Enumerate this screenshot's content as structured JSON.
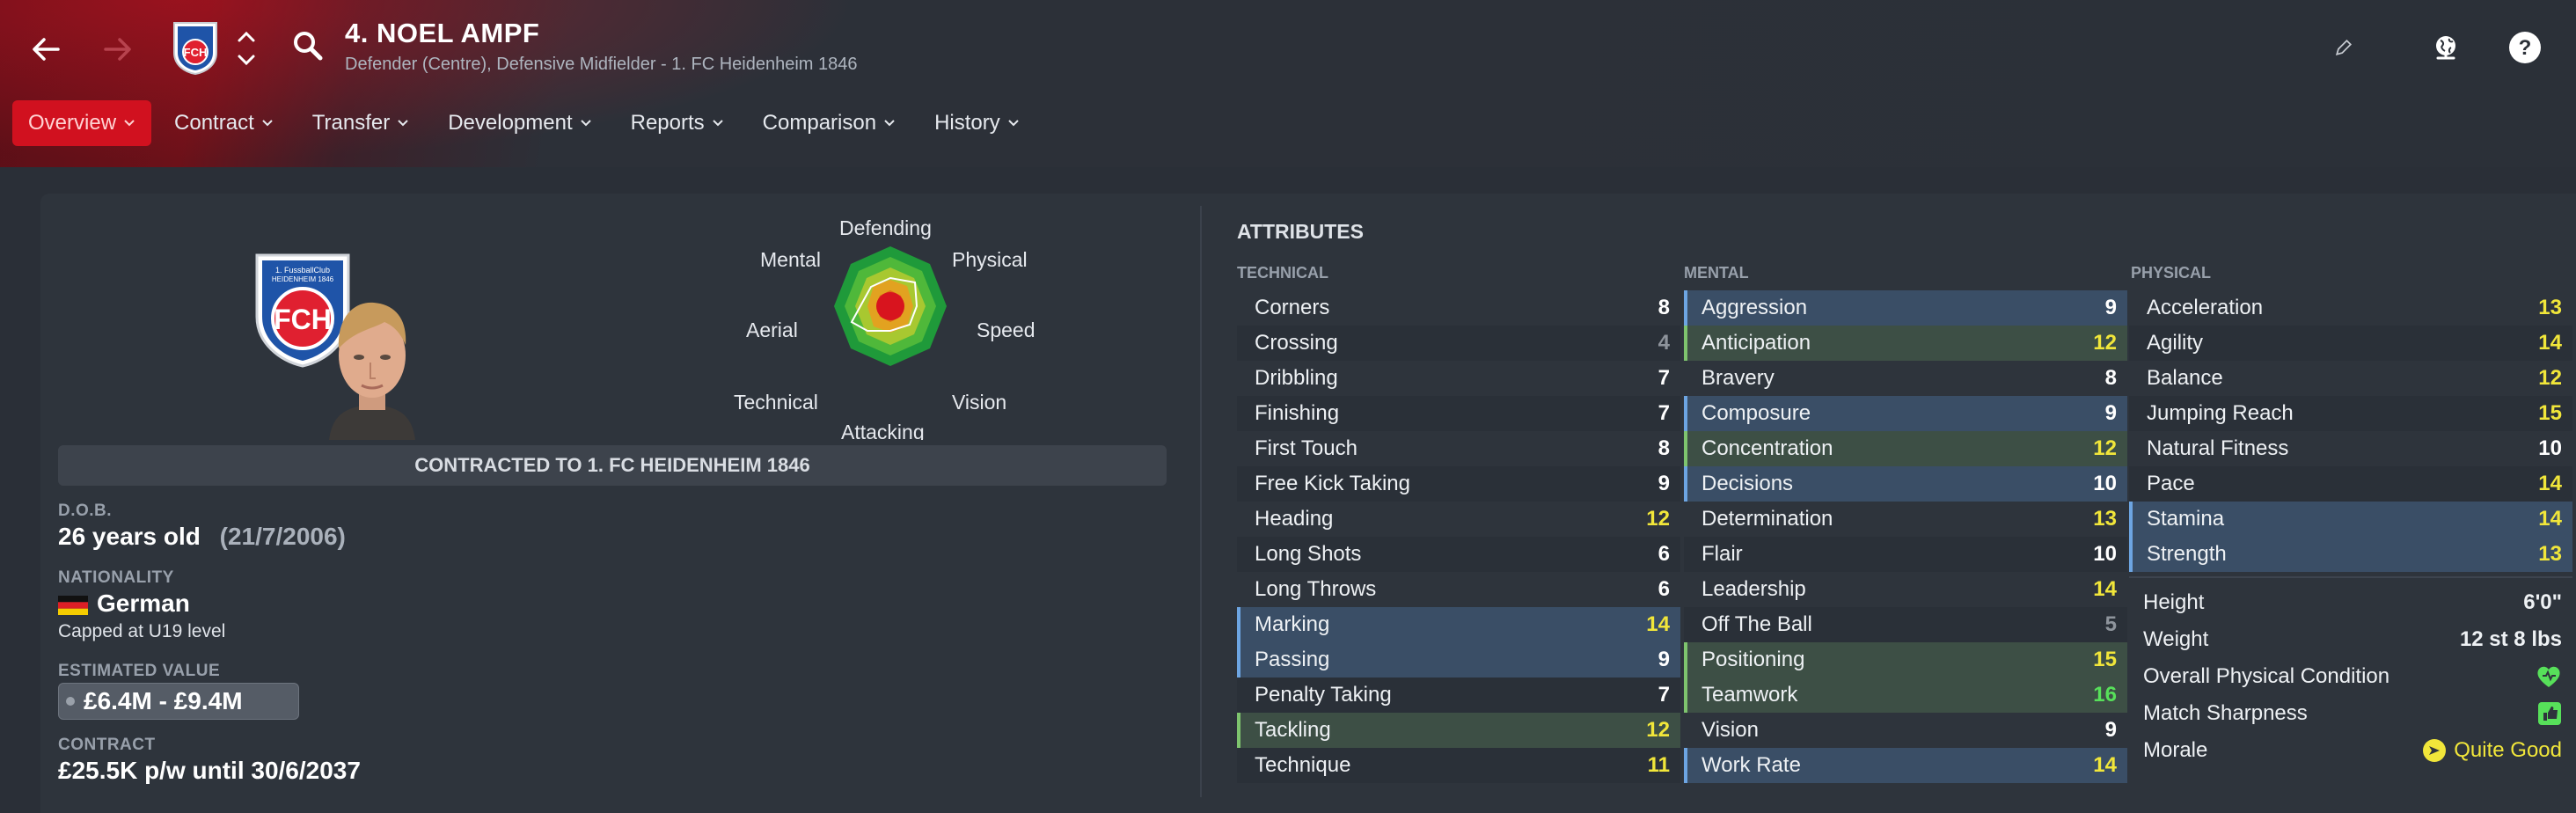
{
  "header": {
    "player_name": "4. NOEL AMPF",
    "subtitle": "Defender (Centre), Defensive Midfielder - 1. FC Heidenheim 1846",
    "back_icon": "arrow-left-icon",
    "forward_icon": "arrow-right-icon",
    "search_icon": "search-icon",
    "edit_icon": "pencil-icon",
    "globe_icon": "globe-icon",
    "help_icon": "help-icon",
    "crest_text": "FCH"
  },
  "tabs": [
    {
      "label": "Overview",
      "active": true
    },
    {
      "label": "Contract"
    },
    {
      "label": "Transfer"
    },
    {
      "label": "Development"
    },
    {
      "label": "Reports"
    },
    {
      "label": "Comparison"
    },
    {
      "label": "History"
    }
  ],
  "crest": {
    "top_text": "1. FussballClub",
    "sub_text": "HEIDENHEIM 1846",
    "main_text": "FCH"
  },
  "radar": {
    "labels": [
      "Defending",
      "Physical",
      "Speed",
      "Vision",
      "Attacking",
      "Technical",
      "Aerial",
      "Mental"
    ]
  },
  "summary": {
    "contract_banner": "CONTRACTED TO 1. FC HEIDENHEIM 1846",
    "dob_label": "D.O.B.",
    "age": "26 years old",
    "dob": "(21/7/2006)",
    "nationality_label": "NATIONALITY",
    "nationality": "German",
    "caps": "Capped at U19 level",
    "value_label": "ESTIMATED VALUE",
    "value": "£6.4M - £9.4M",
    "contract_label": "CONTRACT",
    "contract": "£25.5K p/w until 30/6/2037"
  },
  "attributes": {
    "title": "ATTRIBUTES",
    "technical_title": "TECHNICAL",
    "mental_title": "MENTAL",
    "physical_title": "PHYSICAL",
    "technical": [
      {
        "name": "Corners",
        "value": "8",
        "tone": "white"
      },
      {
        "name": "Crossing",
        "value": "4",
        "tone": "grey"
      },
      {
        "name": "Dribbling",
        "value": "7",
        "tone": "white"
      },
      {
        "name": "Finishing",
        "value": "7",
        "tone": "white"
      },
      {
        "name": "First Touch",
        "value": "8",
        "tone": "white"
      },
      {
        "name": "Free Kick Taking",
        "value": "9",
        "tone": "white"
      },
      {
        "name": "Heading",
        "value": "12",
        "tone": "yellow"
      },
      {
        "name": "Long Shots",
        "value": "6",
        "tone": "white"
      },
      {
        "name": "Long Throws",
        "value": "6",
        "tone": "white"
      },
      {
        "name": "Marking",
        "value": "14",
        "tone": "yellow",
        "hl": "blue"
      },
      {
        "name": "Passing",
        "value": "9",
        "tone": "white",
        "hl": "blue"
      },
      {
        "name": "Penalty Taking",
        "value": "7",
        "tone": "white"
      },
      {
        "name": "Tackling",
        "value": "12",
        "tone": "yellow",
        "hl": "green"
      },
      {
        "name": "Technique",
        "value": "11",
        "tone": "yellow"
      }
    ],
    "mental": [
      {
        "name": "Aggression",
        "value": "9",
        "tone": "white",
        "hl": "blue"
      },
      {
        "name": "Anticipation",
        "value": "12",
        "tone": "yellow",
        "hl": "green"
      },
      {
        "name": "Bravery",
        "value": "8",
        "tone": "white"
      },
      {
        "name": "Composure",
        "value": "9",
        "tone": "white",
        "hl": "blue"
      },
      {
        "name": "Concentration",
        "value": "12",
        "tone": "yellow",
        "hl": "green"
      },
      {
        "name": "Decisions",
        "value": "10",
        "tone": "white",
        "hl": "blue"
      },
      {
        "name": "Determination",
        "value": "13",
        "tone": "yellow"
      },
      {
        "name": "Flair",
        "value": "10",
        "tone": "white"
      },
      {
        "name": "Leadership",
        "value": "14",
        "tone": "yellow"
      },
      {
        "name": "Off The Ball",
        "value": "5",
        "tone": "grey"
      },
      {
        "name": "Positioning",
        "value": "15",
        "tone": "yellow",
        "hl": "green"
      },
      {
        "name": "Teamwork",
        "value": "16",
        "tone": "green",
        "hl": "green"
      },
      {
        "name": "Vision",
        "value": "9",
        "tone": "white"
      },
      {
        "name": "Work Rate",
        "value": "14",
        "tone": "yellow",
        "hl": "blue"
      }
    ],
    "physical": [
      {
        "name": "Acceleration",
        "value": "13",
        "tone": "yellow"
      },
      {
        "name": "Agility",
        "value": "14",
        "tone": "yellow"
      },
      {
        "name": "Balance",
        "value": "12",
        "tone": "yellow"
      },
      {
        "name": "Jumping Reach",
        "value": "15",
        "tone": "yellow"
      },
      {
        "name": "Natural Fitness",
        "value": "10",
        "tone": "white"
      },
      {
        "name": "Pace",
        "value": "14",
        "tone": "yellow"
      },
      {
        "name": "Stamina",
        "value": "14",
        "tone": "yellow",
        "hl": "blue"
      },
      {
        "name": "Strength",
        "value": "13",
        "tone": "yellow",
        "hl": "blue"
      }
    ],
    "physical_extra": {
      "height_label": "Height",
      "height": "6'0\"",
      "weight_label": "Weight",
      "weight": "12 st 8 lbs",
      "condition_label": "Overall Physical Condition",
      "condition_icon": "heart-icon",
      "sharpness_label": "Match Sharpness",
      "sharpness_icon": "thumbs-up-icon",
      "morale_label": "Morale",
      "morale": "Quite Good"
    }
  },
  "colors": {
    "accent": "#d1111f",
    "yellow": "#f1e63a",
    "green": "#57e05a"
  }
}
